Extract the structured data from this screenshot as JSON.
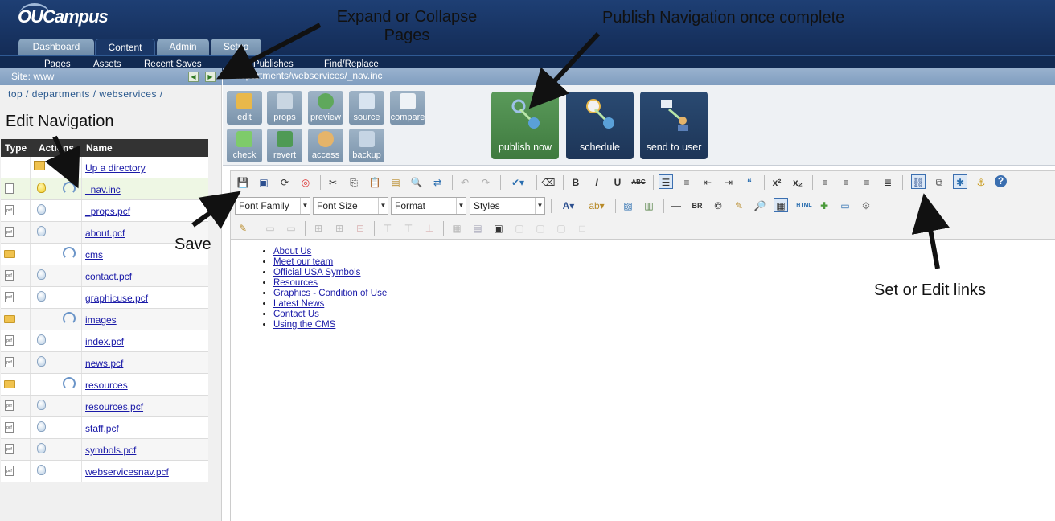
{
  "app": {
    "logo": "OUCampus"
  },
  "tabs": [
    {
      "label": "Dashboard",
      "active": false
    },
    {
      "label": "Content",
      "active": true
    },
    {
      "label": "Admin",
      "active": false
    },
    {
      "label": "Setup",
      "active": false
    }
  ],
  "subnav": [
    "Pages",
    "Assets",
    "Recent Saves",
    "Last Publishes",
    "Find/Replace"
  ],
  "site": {
    "label": "Site: www"
  },
  "path": "/departments/webservices/_nav.inc",
  "breadcrumb": [
    "top",
    "departments",
    "webservices"
  ],
  "filelist": {
    "headers": {
      "type": "Type",
      "actions": "Actions",
      "name": "Name"
    },
    "up": "Up a directory",
    "rows": [
      {
        "name": "_nav.inc",
        "kind": "file",
        "selected": true
      },
      {
        "name": "_props.pcf",
        "kind": "pcf"
      },
      {
        "name": "about.pcf",
        "kind": "pcf"
      },
      {
        "name": "cms",
        "kind": "folder"
      },
      {
        "name": "contact.pcf",
        "kind": "pcf"
      },
      {
        "name": "graphicuse.pcf",
        "kind": "pcf"
      },
      {
        "name": "images",
        "kind": "folder"
      },
      {
        "name": "index.pcf",
        "kind": "pcf"
      },
      {
        "name": "news.pcf",
        "kind": "pcf"
      },
      {
        "name": "resources",
        "kind": "folder"
      },
      {
        "name": "resources.pcf",
        "kind": "pcf"
      },
      {
        "name": "staff.pcf",
        "kind": "pcf"
      },
      {
        "name": "symbols.pcf",
        "kind": "pcf"
      },
      {
        "name": "webservicesnav.pcf",
        "kind": "pcf"
      }
    ]
  },
  "toolbar": {
    "edit": "edit",
    "props": "props",
    "preview": "preview",
    "source": "source",
    "compare": "compare",
    "check": "check",
    "revert": "revert",
    "access": "access",
    "backup": "backup",
    "publish_now": "publish now",
    "schedule": "schedule",
    "send_to_user": "send to user"
  },
  "editor": {
    "font_family": "Font Family",
    "font_size": "Font Size",
    "format": "Format",
    "styles": "Styles",
    "links": [
      "About Us",
      "Meet our team",
      "Official USA Symbols",
      "Resources",
      "Graphics - Condition of Use",
      "Latest News",
      "Contact Us",
      "Using the CMS"
    ]
  },
  "annotations": {
    "expand_line1": "Expand or Collapse",
    "expand_line2": "Pages",
    "publish": "Publish Navigation once complete",
    "edit_nav": "Edit Navigation",
    "save": "Save",
    "links": "Set or Edit links"
  },
  "colors": {
    "header": "#16305d",
    "publish_green": "#3f7a3f",
    "dark_button": "#1d3557"
  }
}
